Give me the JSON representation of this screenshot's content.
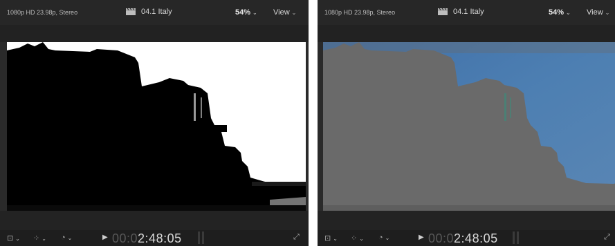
{
  "viewers": [
    {
      "format": "1080p HD 23.98p, Stereo",
      "clip_name": "04.1 Italy",
      "zoom": "54%",
      "view_menu": "View",
      "timecode_dim": "00:0",
      "timecode_lit": "2:48:05"
    },
    {
      "format": "1080p HD 23.98p, Stereo",
      "clip_name": "04.1 Italy",
      "zoom": "54%",
      "view_menu": "View",
      "timecode_dim": "00:0",
      "timecode_lit": "2:48:05"
    }
  ],
  "icons": {
    "clapper": "clapperboard-icon",
    "transform": "transform-icon",
    "enhance": "magic-wand-icon",
    "speed": "speedometer-icon",
    "play": "play-icon",
    "fullscreen": "fullscreen-icon"
  },
  "glyphs": {
    "chevron": "⌄",
    "play": "▶",
    "expand": "⤢",
    "transform": "⊡",
    "enhance": "⁘",
    "speed": "◔"
  },
  "colors": {
    "mask_white": "#ffffff",
    "mask_black": "#000000",
    "sky_blue": "#4a78a8",
    "grey_fill": "#6a6a6a"
  }
}
